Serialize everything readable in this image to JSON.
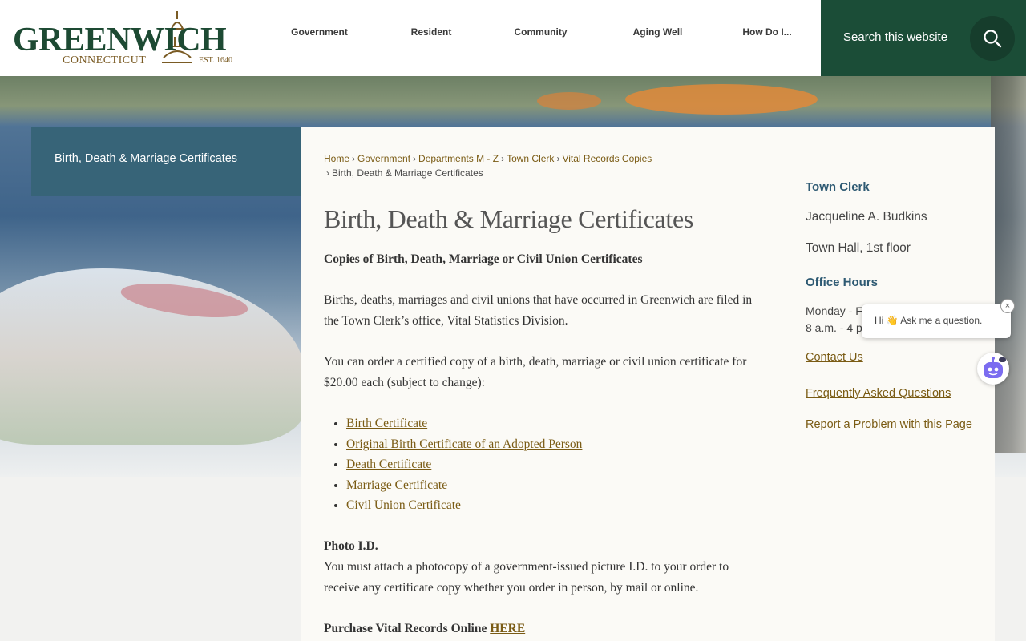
{
  "header": {
    "logo": {
      "main": "GREENWICH",
      "sub": "CONNECTICUT",
      "est": "EST. 1640"
    },
    "nav": [
      {
        "label": "Government"
      },
      {
        "label": "Resident"
      },
      {
        "label": "Community"
      },
      {
        "label": "Aging Well"
      },
      {
        "label": "How Do I..."
      }
    ],
    "search": {
      "placeholder": "Search this website",
      "icon": "search-icon"
    }
  },
  "side_nav": {
    "items": [
      {
        "label": "Birth, Death & Marriage Certificates"
      }
    ]
  },
  "breadcrumb": {
    "items": [
      "Home",
      "Government",
      "Departments M - Z",
      "Town Clerk",
      "Vital Records Copies"
    ],
    "current": "Birth, Death & Marriage Certificates"
  },
  "page": {
    "title": "Birth, Death & Marriage Certificates",
    "subtitle": "Copies of Birth, Death, Marriage or Civil Union Certificates",
    "para1": "Births, deaths, marriages and civil unions that have occurred in Greenwich are filed in the Town Clerk’s office, Vital Statistics Division.",
    "para2": "You can order a certified copy of a birth, death, marriage or civil union certificate for $20.00 each (subject to change):",
    "links": [
      "Birth Certificate",
      "Original Birth Certificate of an Adopted Person",
      "Death Certificate",
      "Marriage Certificate",
      "Civil Union Certificate"
    ],
    "photo_heading": "Photo I.D.",
    "photo_text": "You must attach a photocopy of a government-issued picture I.D. to your order to receive any certificate copy whether you order in person, by mail or online.",
    "purchase_text": "Purchase Vital Records Online",
    "purchase_link": "HERE"
  },
  "sidebar_right": {
    "heading": "Town Clerk",
    "name": "Jacqueline A. Budkins",
    "location": "Town Hall, 1st floor",
    "hours_heading": "Office Hours",
    "hours_days": "Monday - F",
    "hours_time": "8 a.m. - 4 p.m.",
    "links": [
      "Contact Us",
      "Frequently Asked Questions",
      "Report a Problem with this Page"
    ]
  },
  "chat": {
    "message": "Hi 👋 Ask me a question.",
    "close": "×"
  },
  "colors": {
    "brand_green": "#1b4d37",
    "side_nav": "#376478",
    "link_gold": "#7a5b14",
    "heading_blue": "#2e5a73"
  }
}
